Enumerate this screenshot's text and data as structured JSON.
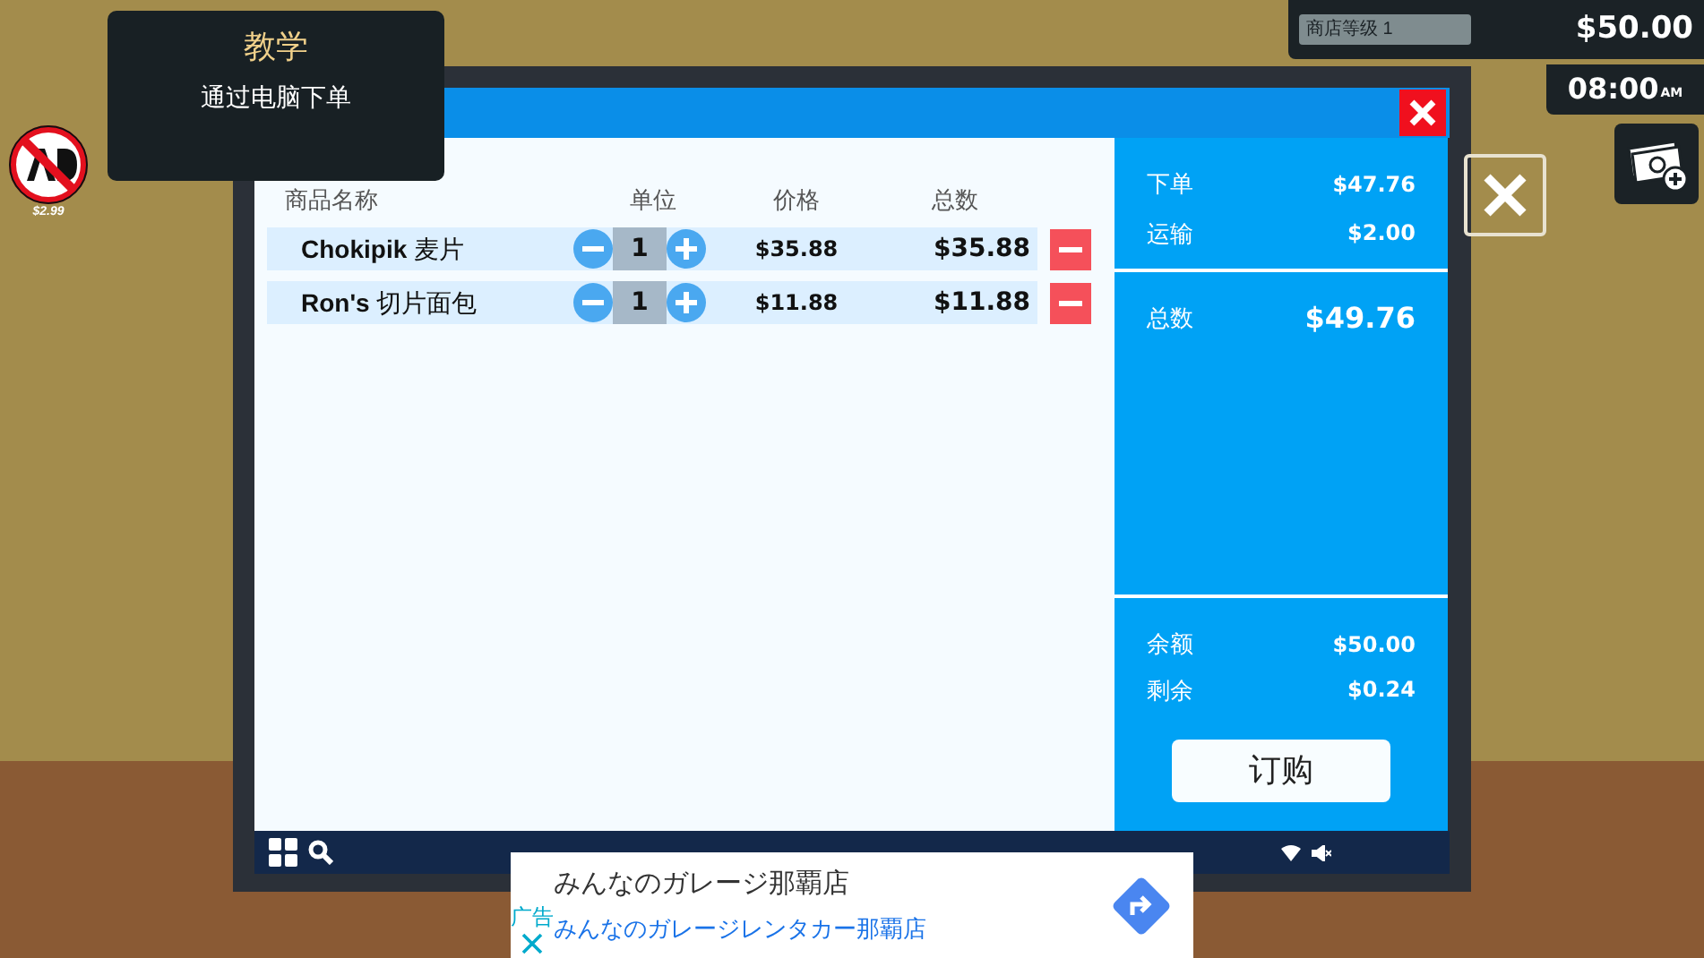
{
  "tutorial": {
    "title": "教学",
    "text": "通过电脑下单"
  },
  "hud": {
    "level_label": "商店等级 1",
    "money": "$50.00",
    "time": "08:00",
    "time_suffix": "AM"
  },
  "ad_badge": {
    "price": "$2.99"
  },
  "order_window": {
    "columns": [
      "商品名称",
      "单位",
      "价格",
      "总数"
    ],
    "items": [
      {
        "name": "**Chokipik** 麦片",
        "quantity": "1",
        "price": "$35.88",
        "total": "$35.88"
      },
      {
        "name": "**Ron's** 切片面包",
        "quantity": "1",
        "price": "$11.88",
        "total": "$11.88"
      }
    ],
    "summary": [
      {
        "label": "下单",
        "value": "$47.76"
      },
      {
        "label": "运输",
        "value": "$2.00"
      }
    ],
    "total": {
      "label": "总数",
      "value": "$49.76"
    },
    "balance": [
      {
        "label": "余额",
        "value": "$50.00"
      },
      {
        "label": "剩余",
        "value": "$0.24"
      }
    ],
    "order_button": "订购"
  },
  "ad_banner": {
    "label": "广告",
    "title": "みんなのガレージ那覇店",
    "subtitle": "みんなのガレージレンタカー那覇店"
  }
}
